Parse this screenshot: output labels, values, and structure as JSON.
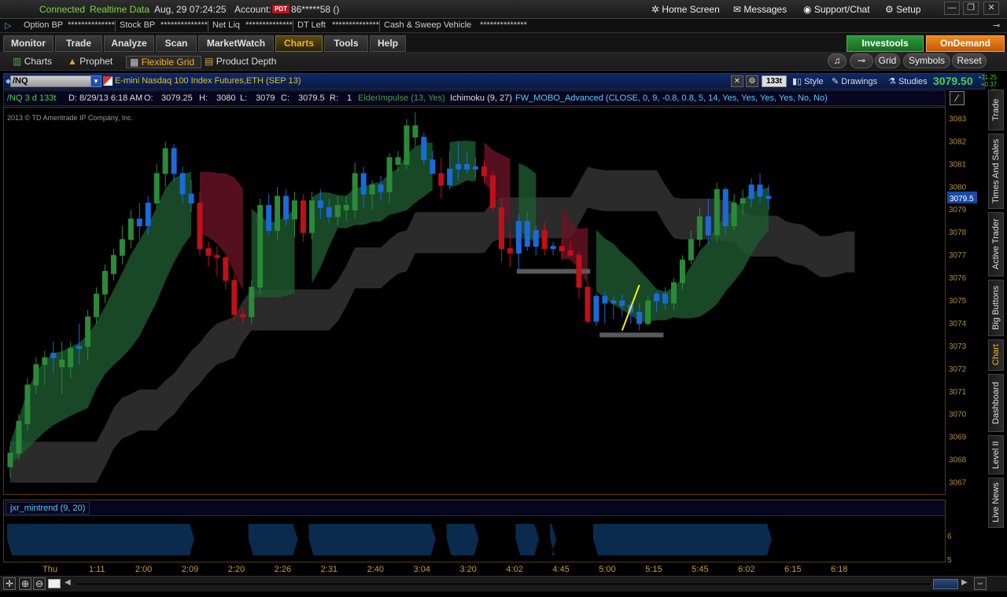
{
  "status": {
    "connected": "Connected",
    "realtime": "Realtime Data",
    "datetime": "Aug, 29  07:24:25",
    "account_label": "Account:",
    "account_badge": "PDT",
    "account_value": "86*****58 ()"
  },
  "header_links": {
    "home": "Home Screen",
    "messages": "Messages",
    "support": "Support/Chat",
    "setup": "Setup"
  },
  "window_controls": {
    "minimize": "—",
    "restore": "❐",
    "close": "✕"
  },
  "metrics": [
    {
      "label": "Option BP",
      "value": "**************"
    },
    {
      "label": "Stock BP",
      "value": "**************"
    },
    {
      "label": "Net Liq",
      "value": "**************"
    },
    {
      "label": "DT Left",
      "value": "**************"
    },
    {
      "label": "Cash & Sweep Vehicle",
      "value": "**************"
    }
  ],
  "tabs": [
    "Monitor",
    "Trade",
    "Analyze",
    "Scan",
    "MarketWatch",
    "Charts",
    "Tools",
    "Help"
  ],
  "active_tab": "Charts",
  "brand_buttons": {
    "investools": "Investools",
    "ondemand": "OnDemand"
  },
  "subnav": [
    "Charts",
    "Prophet",
    "Flexible Grid",
    "Product Depth"
  ],
  "subnav_right": [
    "Grid",
    "Symbols",
    "Reset"
  ],
  "symbol": {
    "ticker": "/NQ",
    "description": "E-mini Nasdaq 100 Index Futures,ETH (SEP 13)",
    "aggregation": "133t",
    "style": "Style",
    "drawings": "Drawings",
    "studies": "Studies",
    "last": "3079.50",
    "change": "+11.25",
    "change_pct": "+0.37 %"
  },
  "study_bar": {
    "series": "/NQ 3 d 133t",
    "date": "D: 8/29/13 6:18 AM",
    "o_label": "O:",
    "o": "3079.25",
    "h_label": "H:",
    "h": "3080",
    "l_label": "L:",
    "l": "3079",
    "c_label": "C:",
    "c": "3079.5",
    "r_label": "R:",
    "r": "1",
    "elder": "ElderImpulse (13, Yes)",
    "ichimoku": "Ichimoku (9, 27)",
    "mobo": "FW_MOBO_Advanced (CLOSE, 0, 9, -0.8, 0.8, 5, 14, Yes, Yes, Yes, Yes, No, No)"
  },
  "watermark": "2013 © TD Ameritrade IP Company, Inc.",
  "price_label": "3079.5",
  "lower_study": "jxr_mintrend (9, 20)",
  "lower_axis": [
    "6",
    "5"
  ],
  "side_tabs": [
    "Trade",
    "Times And Sales",
    "Active Trader",
    "Big Buttons",
    "Chart",
    "Dashboard",
    "Level II",
    "Live News"
  ],
  "active_side_tab": "Chart",
  "colors": {
    "accent": "#f2b218",
    "up_green": "#2a8a3a",
    "down_red": "#c0101a",
    "impulse_blue": "#1a6ad8",
    "cloud_gray": "#3a3a3a",
    "mobo_green": "#1e5a2e",
    "mobo_red": "#6a1428",
    "trend_yellow": "#ffee00"
  },
  "chart_data": {
    "type": "candlestick",
    "symbol": "/NQ",
    "y_ticks": [
      3083,
      3082,
      3081,
      3080,
      3079,
      3078,
      3077,
      3076,
      3075,
      3074,
      3073,
      3072,
      3071,
      3070,
      3069,
      3068,
      3067
    ],
    "ylim": [
      3066.5,
      3083.5
    ],
    "x_ticks": [
      "Thu",
      "1:11",
      "2:00",
      "2:09",
      "2:20",
      "2:26",
      "2:31",
      "2:40",
      "3:04",
      "3:20",
      "4:02",
      "4:45",
      "5:00",
      "5:15",
      "5:45",
      "6:02",
      "6:15",
      "6:18"
    ],
    "candles_ohlc_c": [
      [
        3067.7,
        3068.6,
        3067.2,
        3068.3,
        "g"
      ],
      [
        3068.3,
        3070.0,
        3068.0,
        3069.7,
        "g"
      ],
      [
        3069.6,
        3071.6,
        3069.3,
        3071.3,
        "g"
      ],
      [
        3071.3,
        3072.5,
        3070.9,
        3072.2,
        "g"
      ],
      [
        3072.2,
        3072.8,
        3071.3,
        3072.5,
        "g"
      ],
      [
        3072.5,
        3073.2,
        3071.8,
        3072.7,
        "b"
      ],
      [
        3072.4,
        3073.2,
        3070.9,
        3072.1,
        "g"
      ],
      [
        3072.1,
        3073.2,
        3071.6,
        3072.9,
        "g"
      ],
      [
        3072.9,
        3074.0,
        3072.2,
        3073.0,
        "b"
      ],
      [
        3073.0,
        3074.6,
        3072.4,
        3074.3,
        "g"
      ],
      [
        3074.3,
        3075.6,
        3074.0,
        3075.3,
        "g"
      ],
      [
        3075.3,
        3076.6,
        3074.9,
        3076.3,
        "g"
      ],
      [
        3076.2,
        3077.3,
        3075.9,
        3077.0,
        "g"
      ],
      [
        3077.0,
        3078.3,
        3076.6,
        3077.7,
        "g"
      ],
      [
        3077.7,
        3079.0,
        3077.3,
        3078.6,
        "g"
      ],
      [
        3078.6,
        3079.3,
        3077.7,
        3078.3,
        "b"
      ],
      [
        3078.3,
        3079.6,
        3077.9,
        3079.3,
        "b"
      ],
      [
        3079.3,
        3081.0,
        3079.1,
        3080.6,
        "g"
      ],
      [
        3080.6,
        3082.0,
        3080.0,
        3081.7,
        "g"
      ],
      [
        3081.7,
        3081.9,
        3080.3,
        3080.6,
        "b"
      ],
      [
        3080.6,
        3080.9,
        3079.3,
        3079.7,
        "b"
      ],
      [
        3079.7,
        3080.3,
        3078.9,
        3079.3,
        "b"
      ],
      [
        3079.3,
        3079.8,
        3077.0,
        3077.3,
        "r"
      ],
      [
        3077.3,
        3077.6,
        3076.5,
        3077.0,
        "r"
      ],
      [
        3077.0,
        3077.4,
        3076.1,
        3076.9,
        "r"
      ],
      [
        3076.9,
        3077.0,
        3075.5,
        3075.9,
        "r"
      ],
      [
        3075.9,
        3076.2,
        3074.1,
        3074.4,
        "r"
      ],
      [
        3074.4,
        3074.7,
        3074.0,
        3074.3,
        "r"
      ],
      [
        3074.3,
        3075.9,
        3074.0,
        3075.6,
        "g"
      ],
      [
        3075.6,
        3079.5,
        3075.3,
        3079.2,
        "g"
      ],
      [
        3079.2,
        3079.7,
        3077.9,
        3078.1,
        "b"
      ],
      [
        3078.1,
        3080.0,
        3077.7,
        3079.6,
        "g"
      ],
      [
        3079.6,
        3079.9,
        3078.3,
        3078.6,
        "b"
      ],
      [
        3078.6,
        3079.8,
        3077.8,
        3079.4,
        "g"
      ],
      [
        3079.4,
        3079.7,
        3077.6,
        3078.0,
        "r"
      ],
      [
        3078.0,
        3079.8,
        3077.7,
        3079.4,
        "g"
      ],
      [
        3079.4,
        3079.9,
        3078.6,
        3079.1,
        "b"
      ],
      [
        3079.1,
        3079.5,
        3078.4,
        3078.7,
        "b"
      ],
      [
        3078.7,
        3079.6,
        3078.3,
        3079.2,
        "g"
      ],
      [
        3079.2,
        3079.6,
        3078.5,
        3079.0,
        "g"
      ],
      [
        3079.0,
        3081.1,
        3078.6,
        3080.6,
        "g"
      ],
      [
        3080.6,
        3080.9,
        3079.1,
        3079.7,
        "b"
      ],
      [
        3079.7,
        3080.3,
        3079.0,
        3080.1,
        "g"
      ],
      [
        3080.1,
        3080.5,
        3079.4,
        3079.8,
        "b"
      ],
      [
        3079.8,
        3081.5,
        3079.3,
        3081.3,
        "g"
      ],
      [
        3081.3,
        3081.6,
        3080.7,
        3081.0,
        "g"
      ],
      [
        3081.0,
        3083.0,
        3080.8,
        3082.7,
        "g"
      ],
      [
        3082.7,
        3083.3,
        3081.8,
        3082.2,
        "g"
      ],
      [
        3082.2,
        3082.4,
        3081.0,
        3081.2,
        "b"
      ],
      [
        3081.2,
        3081.6,
        3080.6,
        3080.6,
        "b"
      ],
      [
        3080.6,
        3081.3,
        3079.5,
        3080.1,
        "r"
      ],
      [
        3080.1,
        3081.6,
        3079.9,
        3080.8,
        "b"
      ],
      [
        3080.8,
        3082.0,
        3080.3,
        3081.0,
        "b"
      ],
      [
        3081.0,
        3081.5,
        3080.6,
        3080.8,
        "b"
      ],
      [
        3080.8,
        3081.3,
        3080.4,
        3080.9,
        "b"
      ],
      [
        3080.9,
        3081.2,
        3080.2,
        3080.5,
        "r"
      ],
      [
        3080.5,
        3080.7,
        3078.9,
        3079.1,
        "r"
      ],
      [
        3079.1,
        3079.5,
        3076.7,
        3077.3,
        "r"
      ],
      [
        3077.3,
        3078.1,
        3076.5,
        3077.1,
        "r"
      ],
      [
        3077.1,
        3078.8,
        3076.4,
        3078.5,
        "b"
      ],
      [
        3078.5,
        3078.9,
        3077.2,
        3077.4,
        "b"
      ],
      [
        3077.4,
        3078.3,
        3077.0,
        3078.1,
        "b"
      ],
      [
        3078.1,
        3078.5,
        3077.0,
        3077.3,
        "r"
      ],
      [
        3077.3,
        3077.6,
        3077.0,
        3077.4,
        "b"
      ],
      [
        3077.4,
        3077.7,
        3076.8,
        3077.2,
        "r"
      ],
      [
        3077.2,
        3077.6,
        3076.9,
        3077.0,
        "r"
      ],
      [
        3077.0,
        3077.2,
        3075.1,
        3075.6,
        "r"
      ],
      [
        3075.6,
        3075.8,
        3074.0,
        3074.1,
        "r"
      ],
      [
        3074.1,
        3075.3,
        3073.9,
        3075.2,
        "b"
      ],
      [
        3075.2,
        3075.4,
        3074.0,
        3074.9,
        "b"
      ],
      [
        3074.9,
        3075.2,
        3074.2,
        3075.0,
        "b"
      ],
      [
        3075.0,
        3075.3,
        3074.3,
        3074.8,
        "b"
      ],
      [
        3074.8,
        3075.0,
        3074.0,
        3074.5,
        "b"
      ],
      [
        3074.5,
        3074.9,
        3073.7,
        3074.0,
        "b"
      ],
      [
        3074.0,
        3075.2,
        3073.9,
        3075.0,
        "g"
      ],
      [
        3075.0,
        3075.4,
        3074.5,
        3075.3,
        "b"
      ],
      [
        3075.3,
        3075.6,
        3074.6,
        3074.9,
        "b"
      ],
      [
        3074.9,
        3076.0,
        3074.6,
        3075.8,
        "g"
      ],
      [
        3075.8,
        3077.0,
        3075.5,
        3076.8,
        "g"
      ],
      [
        3076.8,
        3078.1,
        3076.6,
        3077.7,
        "g"
      ],
      [
        3077.7,
        3079.1,
        3077.4,
        3078.7,
        "g"
      ],
      [
        3078.7,
        3079.5,
        3077.5,
        3077.9,
        "b"
      ],
      [
        3077.9,
        3080.2,
        3077.6,
        3079.9,
        "g"
      ],
      [
        3079.9,
        3080.0,
        3077.9,
        3078.3,
        "b"
      ],
      [
        3078.3,
        3079.7,
        3078.1,
        3079.3,
        "g"
      ],
      [
        3079.3,
        3079.9,
        3078.8,
        3079.5,
        "g"
      ],
      [
        3079.5,
        3080.4,
        3079.1,
        3080.1,
        "b"
      ],
      [
        3080.1,
        3080.6,
        3079.3,
        3079.6,
        "b"
      ],
      [
        3079.6,
        3080.1,
        3079.0,
        3079.5,
        "b"
      ]
    ],
    "support_lines": [
      {
        "y": 3076.3,
        "x_from": 0.545,
        "x_to": 0.623
      },
      {
        "y": 3073.5,
        "x_from": 0.633,
        "x_to": 0.701
      }
    ],
    "trend_line": {
      "y_from": 3073.7,
      "y_to": 3075.7
    }
  }
}
